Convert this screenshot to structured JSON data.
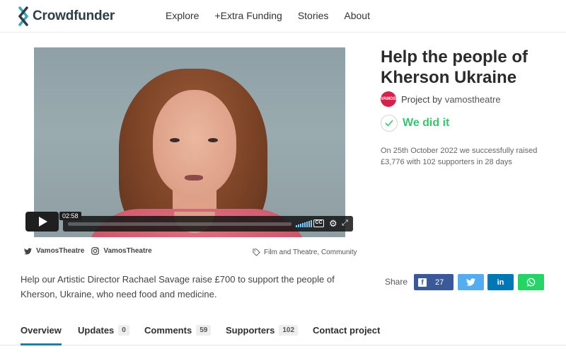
{
  "header": {
    "logo_text": "Crowdfunder",
    "nav": [
      "Explore",
      "+Extra Funding",
      "Stories",
      "About"
    ]
  },
  "video": {
    "time": "02:58",
    "controls": {
      "play_icon": "play-icon",
      "captions_label": "CC",
      "settings_icon": "gear-icon",
      "fullscreen_icon": "fullscreen-icon"
    }
  },
  "social": {
    "twitter": "VamosTheatre",
    "instagram": "VamosTheatre"
  },
  "tags": "Film and Theatre, Community",
  "project": {
    "title": "Help the people of Kherson Ukraine",
    "by_label": "Project by",
    "owner": "vamostheatre",
    "avatar_text": "VAMOS",
    "status": "We did it",
    "summary": "On 25th October 2022 we successfully raised £3,776 with 102 supporters in 28 days"
  },
  "description": "Help our Artistic Director Rachael Savage raise £700 to support the people of Kherson, Ukraine, who need food and medicine.",
  "share": {
    "label": "Share",
    "facebook_count": "27",
    "linkedin_label": "in"
  },
  "tabs": [
    {
      "label": "Overview",
      "count": ""
    },
    {
      "label": "Updates",
      "count": "0"
    },
    {
      "label": "Comments",
      "count": "59"
    },
    {
      "label": "Supporters",
      "count": "102"
    },
    {
      "label": "Contact project",
      "count": ""
    }
  ],
  "colors": {
    "brand_dark": "#2f3d45",
    "brand_teal": "#3aa6b9",
    "success": "#3fbf72",
    "facebook": "#3b5998",
    "twitter": "#55acee",
    "linkedin": "#0077b5",
    "whatsapp": "#25d366",
    "tab_active": "#1b7fa6"
  }
}
